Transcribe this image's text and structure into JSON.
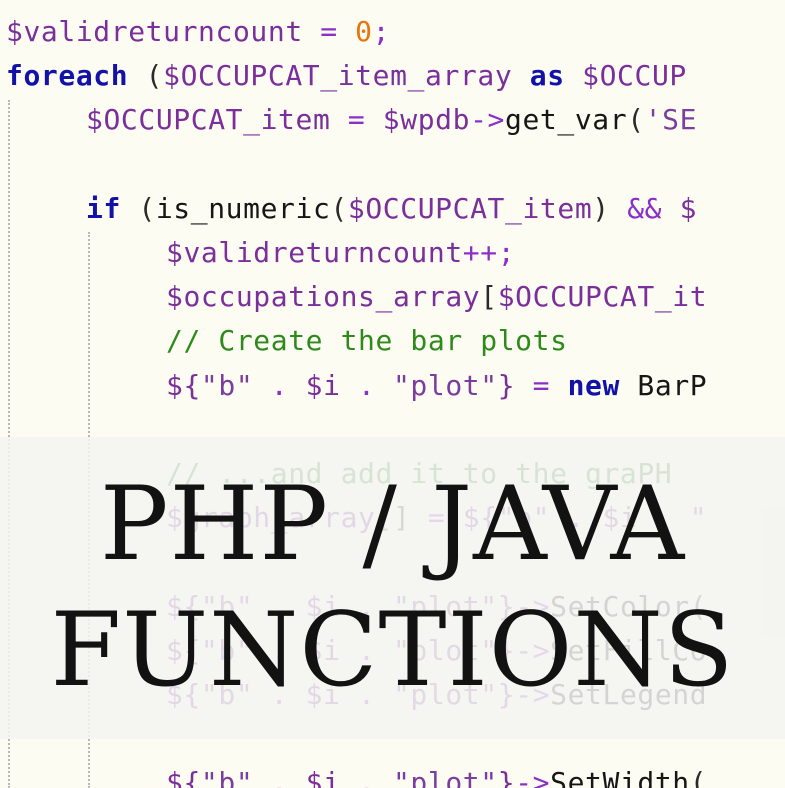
{
  "code_lines": [
    {
      "indent": 0,
      "tokens": [
        {
          "cls": "v",
          "t": "$validreturncount"
        },
        {
          "cls": "o",
          "t": " = "
        },
        {
          "cls": "n",
          "t": "0"
        },
        {
          "cls": "o",
          "t": ";"
        }
      ]
    },
    {
      "indent": 0,
      "tokens": [
        {
          "cls": "k",
          "t": "foreach"
        },
        {
          "cls": "p",
          "t": " ("
        },
        {
          "cls": "v",
          "t": "$OCCUPCAT_item_array"
        },
        {
          "cls": "p",
          "t": " "
        },
        {
          "cls": "k",
          "t": "as"
        },
        {
          "cls": "p",
          "t": " "
        },
        {
          "cls": "v",
          "t": "$OCCUP"
        }
      ]
    },
    {
      "indent": 1,
      "tokens": [
        {
          "cls": "v",
          "t": "$OCCUPCAT_item"
        },
        {
          "cls": "o",
          "t": " = "
        },
        {
          "cls": "v",
          "t": "$wpdb"
        },
        {
          "cls": "o",
          "t": "->"
        },
        {
          "cls": "f",
          "t": "get_var"
        },
        {
          "cls": "p",
          "t": "("
        },
        {
          "cls": "s",
          "t": "'SE"
        }
      ]
    },
    {
      "indent": 1,
      "tokens": []
    },
    {
      "indent": 1,
      "tokens": [
        {
          "cls": "k",
          "t": "if"
        },
        {
          "cls": "p",
          "t": " ("
        },
        {
          "cls": "f",
          "t": "is_numeric"
        },
        {
          "cls": "p",
          "t": "("
        },
        {
          "cls": "v",
          "t": "$OCCUPCAT_item"
        },
        {
          "cls": "p",
          "t": ") "
        },
        {
          "cls": "o",
          "t": "&&"
        },
        {
          "cls": "p",
          "t": " "
        },
        {
          "cls": "v",
          "t": "$"
        }
      ]
    },
    {
      "indent": 2,
      "tokens": [
        {
          "cls": "v",
          "t": "$validreturncount"
        },
        {
          "cls": "o",
          "t": "++;"
        }
      ]
    },
    {
      "indent": 2,
      "tokens": [
        {
          "cls": "v",
          "t": "$occupations_array"
        },
        {
          "cls": "p",
          "t": "["
        },
        {
          "cls": "v",
          "t": "$OCCUPCAT_it"
        }
      ]
    },
    {
      "indent": 2,
      "tokens": [
        {
          "cls": "c",
          "t": "// Create the bar plots"
        }
      ]
    },
    {
      "indent": 2,
      "tokens": [
        {
          "cls": "v",
          "t": "${"
        },
        {
          "cls": "s",
          "t": "\"b\""
        },
        {
          "cls": "o",
          "t": " . "
        },
        {
          "cls": "v",
          "t": "$i"
        },
        {
          "cls": "o",
          "t": " . "
        },
        {
          "cls": "s",
          "t": "\"plot\""
        },
        {
          "cls": "v",
          "t": "}"
        },
        {
          "cls": "o",
          "t": " = "
        },
        {
          "cls": "k",
          "t": "new"
        },
        {
          "cls": "p",
          "t": " "
        },
        {
          "cls": "f",
          "t": "BarP"
        }
      ]
    },
    {
      "indent": 2,
      "tokens": []
    },
    {
      "indent": 2,
      "tokens": [
        {
          "cls": "c",
          "t": "// ...and add it to the graPH"
        }
      ]
    },
    {
      "indent": 2,
      "tokens": [
        {
          "cls": "v",
          "t": "$graph_array"
        },
        {
          "cls": "p",
          "t": "[]"
        },
        {
          "cls": "o",
          "t": " = "
        },
        {
          "cls": "v",
          "t": "${"
        },
        {
          "cls": "s",
          "t": "\"b\""
        },
        {
          "cls": "o",
          "t": " . "
        },
        {
          "cls": "v",
          "t": "$i"
        },
        {
          "cls": "o",
          "t": " . "
        },
        {
          "cls": "s",
          "t": "\""
        }
      ]
    },
    {
      "indent": 2,
      "tokens": []
    },
    {
      "indent": 2,
      "tokens": [
        {
          "cls": "v",
          "t": "${"
        },
        {
          "cls": "s",
          "t": "\"b\""
        },
        {
          "cls": "o",
          "t": " . "
        },
        {
          "cls": "v",
          "t": "$i"
        },
        {
          "cls": "o",
          "t": " . "
        },
        {
          "cls": "s",
          "t": "\"plot\""
        },
        {
          "cls": "v",
          "t": "}"
        },
        {
          "cls": "o",
          "t": "->"
        },
        {
          "cls": "f",
          "t": "SetColor"
        },
        {
          "cls": "p",
          "t": "("
        }
      ]
    },
    {
      "indent": 2,
      "tokens": [
        {
          "cls": "v",
          "t": "${"
        },
        {
          "cls": "s",
          "t": "\"b\""
        },
        {
          "cls": "o",
          "t": " . "
        },
        {
          "cls": "v",
          "t": "$i"
        },
        {
          "cls": "o",
          "t": " . "
        },
        {
          "cls": "s",
          "t": "\"plot\""
        },
        {
          "cls": "v",
          "t": "}"
        },
        {
          "cls": "o",
          "t": "->"
        },
        {
          "cls": "f",
          "t": "SetFillCo"
        }
      ]
    },
    {
      "indent": 2,
      "tokens": [
        {
          "cls": "v",
          "t": "${"
        },
        {
          "cls": "s",
          "t": "\"b\""
        },
        {
          "cls": "o",
          "t": " . "
        },
        {
          "cls": "v",
          "t": "$i"
        },
        {
          "cls": "o",
          "t": " . "
        },
        {
          "cls": "s",
          "t": "\"plot\""
        },
        {
          "cls": "v",
          "t": "}"
        },
        {
          "cls": "o",
          "t": "->"
        },
        {
          "cls": "f",
          "t": "SetLegend"
        }
      ]
    },
    {
      "indent": 2,
      "tokens": []
    },
    {
      "indent": 2,
      "tokens": [
        {
          "cls": "v",
          "t": "${"
        },
        {
          "cls": "s",
          "t": "\"b\""
        },
        {
          "cls": "o",
          "t": " . "
        },
        {
          "cls": "v",
          "t": "$i"
        },
        {
          "cls": "o",
          "t": " . "
        },
        {
          "cls": "s",
          "t": "\"plot\""
        },
        {
          "cls": "v",
          "t": "}"
        },
        {
          "cls": "o",
          "t": "->"
        },
        {
          "cls": "f",
          "t": "SetWidth"
        },
        {
          "cls": "p",
          "t": "("
        }
      ]
    }
  ],
  "overlay": {
    "title_line1": "PHP / JAVA",
    "title_line2": "FUNCTIONS"
  }
}
